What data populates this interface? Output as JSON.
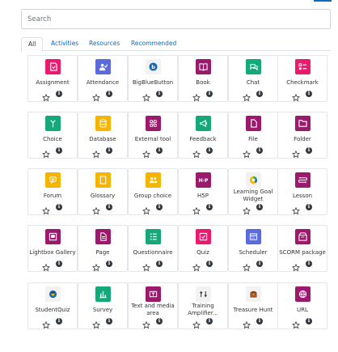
{
  "search": {
    "placeholder": "Search"
  },
  "tabs": [
    {
      "label": "All",
      "active": true
    },
    {
      "label": "Activities",
      "active": false
    },
    {
      "label": "Resources",
      "active": false
    },
    {
      "label": "Recommended",
      "active": false
    }
  ],
  "modules": [
    {
      "name": "Assignment",
      "icon": "assignment-icon",
      "color": "#eb1a6f"
    },
    {
      "name": "Attendance",
      "icon": "attendance-icon",
      "color": "#5b6bdb"
    },
    {
      "name": "BigBlueButton",
      "icon": "bigbluebutton-icon",
      "color": "#f2f2f2"
    },
    {
      "name": "Book",
      "icon": "book-icon",
      "color": "#9c1a6e"
    },
    {
      "name": "Chat",
      "icon": "chat-icon",
      "color": "#17a879"
    },
    {
      "name": "Checkmark",
      "icon": "checkmark-icon",
      "color": "#eb1a6f"
    },
    {
      "name": "Choice",
      "icon": "choice-icon",
      "color": "#17a879"
    },
    {
      "name": "Database",
      "icon": "database-icon",
      "color": "#f4b400"
    },
    {
      "name": "External tool",
      "icon": "external-tool-icon",
      "color": "#9c1a6e"
    },
    {
      "name": "Feedback",
      "icon": "feedback-icon",
      "color": "#17a879"
    },
    {
      "name": "File",
      "icon": "file-icon",
      "color": "#9c1a6e"
    },
    {
      "name": "Folder",
      "icon": "folder-icon",
      "color": "#9c1a6e"
    },
    {
      "name": "Forum",
      "icon": "forum-icon",
      "color": "#f4b400"
    },
    {
      "name": "Glossary",
      "icon": "glossary-icon",
      "color": "#f4b400"
    },
    {
      "name": "Group choice",
      "icon": "group-choice-icon",
      "color": "#f4b400"
    },
    {
      "name": "H5P",
      "icon": "h5p-icon",
      "color": "#9c1a6e"
    },
    {
      "name": "Learning Goal Widget",
      "icon": "learning-goal-widget-icon",
      "color": "#f2f2f2"
    },
    {
      "name": "Lesson",
      "icon": "lesson-icon",
      "color": "#9c1a6e"
    },
    {
      "name": "Lightbox Gallery",
      "icon": "lightbox-gallery-icon",
      "color": "#9c1a6e"
    },
    {
      "name": "Page",
      "icon": "page-icon",
      "color": "#9c1a6e"
    },
    {
      "name": "Questionnaire",
      "icon": "questionnaire-icon",
      "color": "#17a879"
    },
    {
      "name": "Quiz",
      "icon": "quiz-icon",
      "color": "#eb1a6f"
    },
    {
      "name": "Scheduler",
      "icon": "scheduler-icon",
      "color": "#5b6bdb"
    },
    {
      "name": "SCORM package",
      "icon": "scorm-package-icon",
      "color": "#9c1a6e"
    },
    {
      "name": "StudentQuiz",
      "icon": "studentquiz-icon",
      "color": "#f2f2f2"
    },
    {
      "name": "Survey",
      "icon": "survey-icon",
      "color": "#17a879"
    },
    {
      "name": "Text and media area",
      "icon": "text-and-media-area-icon",
      "color": "#9c1a6e"
    },
    {
      "name": "Training Amplifier...",
      "icon": "training-amplifier-icon",
      "color": "#f2f2f2"
    },
    {
      "name": "Treasure Hunt",
      "icon": "treasure-hunt-icon",
      "color": "#f2f2f2"
    },
    {
      "name": "URL",
      "icon": "url-icon",
      "color": "#9c1a6e"
    }
  ],
  "accent": "#0f6cbf"
}
